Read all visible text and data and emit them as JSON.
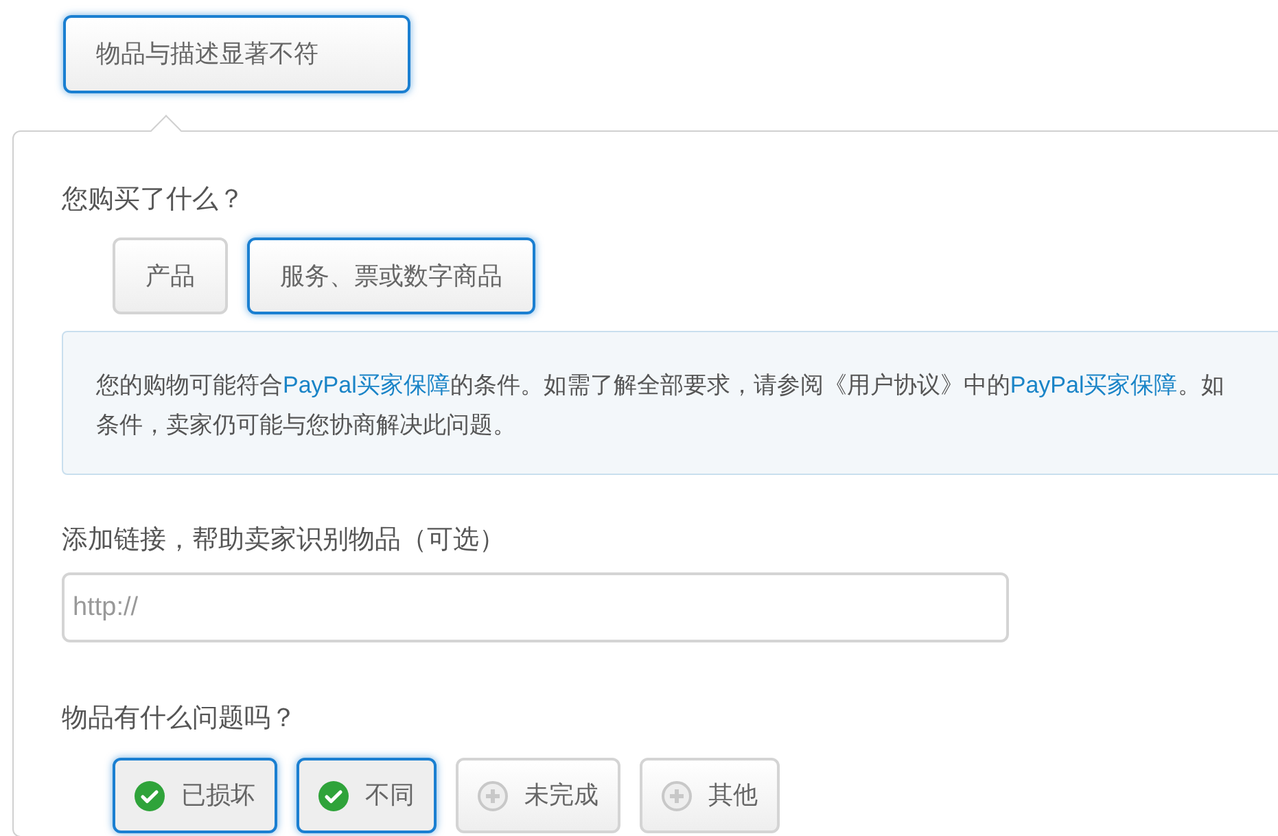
{
  "top_option": {
    "label": "物品与描述显著不符",
    "selected": true
  },
  "purchase_type": {
    "question": "您购买了什么？",
    "options": [
      {
        "label": "产品",
        "selected": false
      },
      {
        "label": "服务、票或数字商品",
        "selected": true
      }
    ]
  },
  "info": {
    "lines": [
      [
        {
          "kind": "text",
          "text": "您的购物可能符合"
        },
        {
          "kind": "link",
          "text": "PayPal买家保障"
        },
        {
          "kind": "text",
          "text": "的条件。如需了解全部要求，请参阅《用户协议》中的"
        },
        {
          "kind": "link",
          "text": "PayPal买家保障"
        },
        {
          "kind": "text",
          "text": "。如"
        }
      ],
      [
        {
          "kind": "text",
          "text": "条件，卖家仍可能与您协商解决此问题。"
        }
      ]
    ]
  },
  "link_field": {
    "label": "添加链接，帮助卖家识别物品（可选）",
    "placeholder": "http://"
  },
  "issues": {
    "question": "物品有什么问题吗？",
    "options": [
      {
        "label": "已损坏",
        "checked": true
      },
      {
        "label": "不同",
        "checked": true
      },
      {
        "label": "未完成",
        "checked": false
      },
      {
        "label": "其他",
        "checked": false
      }
    ]
  }
}
